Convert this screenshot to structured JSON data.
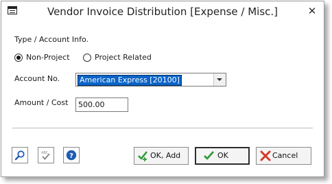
{
  "window": {
    "title": "Vendor Invoice Distribution [Expense / Misc.]",
    "close_glyph": "✕"
  },
  "form": {
    "section_label": "Type / Account Info.",
    "radio_non_project": "Non-Project",
    "radio_project_related": "Project Related",
    "account_label": "Account No.",
    "account_value": "American Express [20100]",
    "amount_label": "Amount / Cost",
    "amount_value": "500.00"
  },
  "toolbar": {
    "search_icon": "magnifier-icon",
    "spellcheck_icon": "abc-check-icon",
    "help_icon": "help-icon"
  },
  "buttons": {
    "ok_add": "OK, Add",
    "ok": "OK",
    "cancel": "Cancel"
  },
  "colors": {
    "selection": "#0a64c8",
    "help_blue": "#1e5cb3",
    "ok_green": "#2e9b3a",
    "cancel_red": "#d63a2a"
  }
}
